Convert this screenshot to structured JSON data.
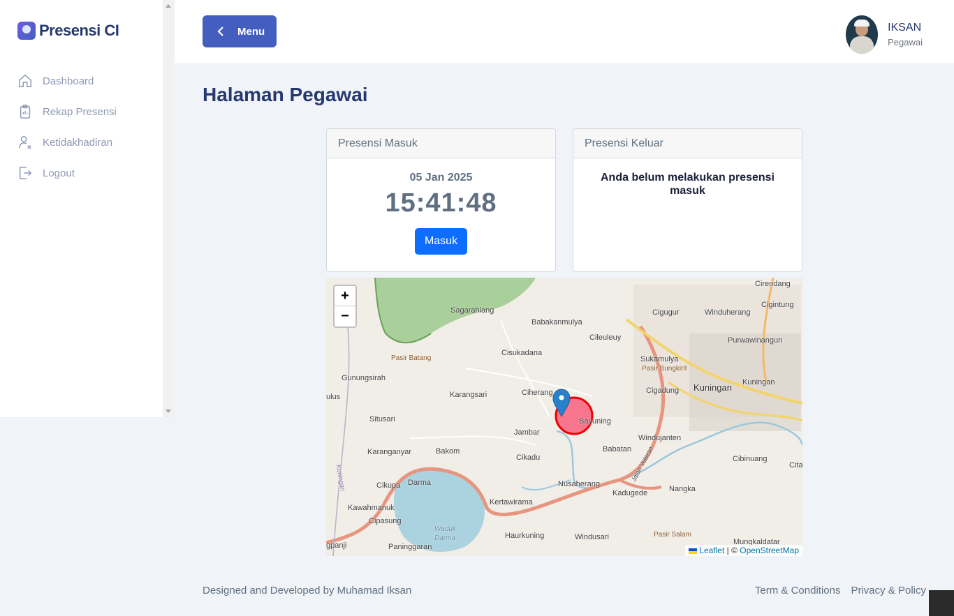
{
  "app": {
    "logo_text": "Presensi CI"
  },
  "sidebar": {
    "items": [
      {
        "label": "Dashboard",
        "icon": "house-icon"
      },
      {
        "label": "Rekap Presensi",
        "icon": "clipboard-icon"
      },
      {
        "label": "Ketidakhadiran",
        "icon": "user-x-icon"
      },
      {
        "label": "Logout",
        "icon": "logout-icon"
      }
    ]
  },
  "header": {
    "menu_label": "Menu",
    "user_name": "IKSAN",
    "user_role": "Pegawai"
  },
  "page": {
    "title": "Halaman Pegawai"
  },
  "presensi_masuk": {
    "title": "Presensi Masuk",
    "date": "05 Jan 2025",
    "time": "15:41:48",
    "button_label": "Masuk"
  },
  "presensi_keluar": {
    "title": "Presensi Keluar",
    "message": "Anda belum melakukan presensi masuk"
  },
  "map": {
    "zoom_in": "+",
    "zoom_out": "−",
    "places": [
      "Cirendang",
      "Cigintung",
      "Sagarahiang",
      "Babakanmulya",
      "Cigugur",
      "Winduherang",
      "Cileuleuy",
      "Purwawinangun",
      "Pasir Batang",
      "Cisukadana",
      "Sukamulya",
      "Pasir Bungkirit",
      "Gunungsirah",
      "Kuningan",
      "Kuningan",
      "Cigadung",
      "Karangsari",
      "Ciherang",
      "ulus",
      "Situsari",
      "Bayuning",
      "Jambar",
      "Babatan",
      "Windujanten",
      "Cibinuang",
      "Karanganyar",
      "Bakom",
      "Cikadu",
      "Cita",
      "Cikupa",
      "Darma",
      "Nusaherang",
      "Kadugede",
      "Nangka",
      "Kawahmanuk",
      "Kertawirama",
      "Cipasung",
      "Waduk",
      "Darma",
      "Haurkuning",
      "Windusari",
      "Pasir Salam",
      "Mungkaldatar",
      "gpanji",
      "Paninggaran",
      "Jalan Veteran",
      "Kuningan"
    ],
    "attribution": {
      "leaflet": "Leaflet",
      "separator": "| ©",
      "osm": "OpenStreetMap"
    }
  },
  "footer": {
    "credit": "Designed and Developed by Muhamad Iksan",
    "terms": "Term & Conditions",
    "privacy": "Privacy & Policy"
  }
}
